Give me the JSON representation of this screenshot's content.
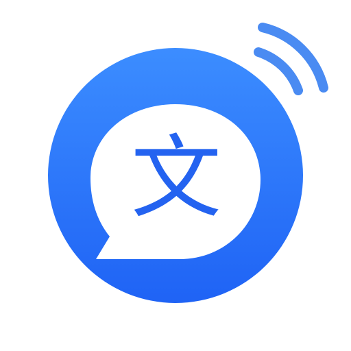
{
  "app_icon": {
    "name": "translator-app-icon",
    "glyph": "文",
    "colors": {
      "circle_top": "#3C8DFF",
      "circle_bottom": "#1F63F5",
      "waves": "#4A8BF2",
      "bubble": "#FFFFFF",
      "glyph": "#2463F0"
    }
  }
}
